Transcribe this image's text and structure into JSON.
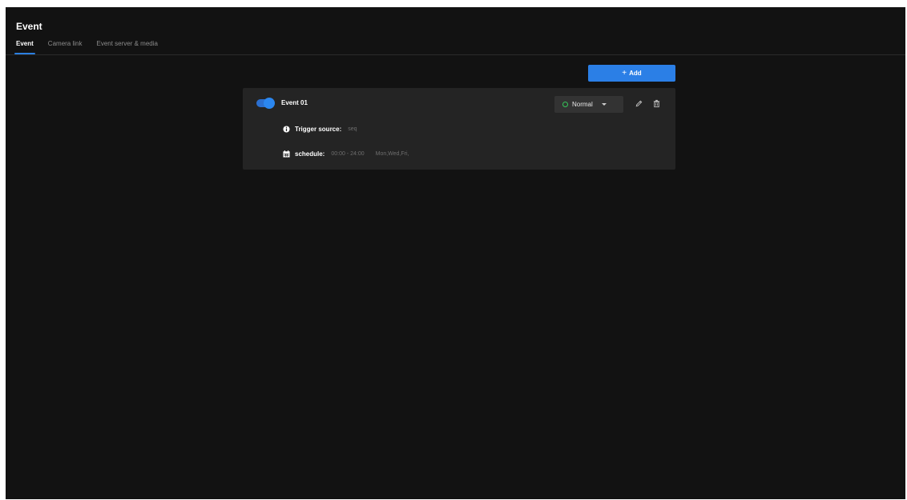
{
  "page": {
    "title": "Event"
  },
  "tabs": [
    {
      "label": "Event",
      "active": true
    },
    {
      "label": "Camera link",
      "active": false
    },
    {
      "label": "Event server & media",
      "active": false
    }
  ],
  "toolbar": {
    "add_label": "Add",
    "add_icon": "plus-icon"
  },
  "event": {
    "enabled": true,
    "name": "Event 01",
    "status": "Normal",
    "status_color": "#34c759",
    "trigger_label": "Trigger source:",
    "trigger_value": "seq",
    "schedule_label": "schedule:",
    "schedule_time": "00:00 - 24:00",
    "schedule_days": "Mon,Wed,Fri,"
  },
  "colors": {
    "accent": "#2b7fe6",
    "background": "#121212",
    "card": "#242424"
  }
}
